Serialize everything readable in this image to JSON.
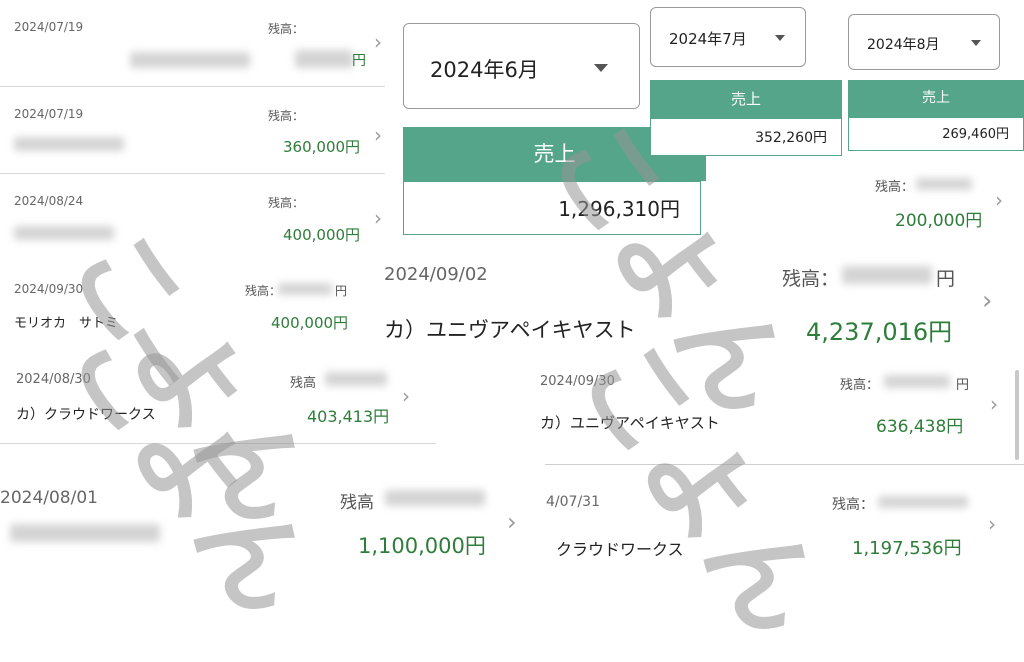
{
  "left_list": [
    {
      "date": "2024/07/19",
      "balance_label": "残高：",
      "name": "",
      "amount": ""
    },
    {
      "date": "2024/07/19",
      "balance_label": "残高：",
      "name": "",
      "amount": "360,000円"
    },
    {
      "date": "2024/08/24",
      "balance_label": "残高：",
      "name": "",
      "amount": "400,000円"
    },
    {
      "date": "2024/09/30",
      "balance_label": "残高：",
      "name": "モリオカ　サトミ",
      "amount": "400,000円"
    },
    {
      "date": "2024/08/30",
      "balance_label": "残高",
      "name": "カ）クラウドワークス",
      "amount": "403,413円"
    },
    {
      "date": "2024/08/01",
      "balance_label": "残高",
      "name": "",
      "amount": "1,100,000円"
    }
  ],
  "partial_yen": "円",
  "month_selectors": {
    "june": {
      "label": "2024年6月"
    },
    "july": {
      "label": "2024年7月"
    },
    "august": {
      "label": "2024年8月"
    }
  },
  "sales": {
    "header": "売上",
    "june": "1,296,310円",
    "july": "352,260円",
    "august": "269,460円"
  },
  "right_list": [
    {
      "date": "",
      "balance_label": "残高：",
      "name": "",
      "amount": "200,000円"
    },
    {
      "date": "2024/09/02",
      "balance_label": "残高：",
      "balance_suffix": "円",
      "name": "カ）ユニヴアペイキヤスト",
      "amount": "4,237,016円"
    },
    {
      "date": "2024/09/30",
      "balance_label": "残高：",
      "balance_suffix": "円",
      "name": "カ）ユニヴアペイキヤスト",
      "amount": "636,438円"
    },
    {
      "date": "4/07/31",
      "balance_label": "残高：",
      "name": "クラウドワークス",
      "amount": "1,197,536円"
    }
  ],
  "watermark": "こよん",
  "colors": {
    "accent": "#55a58a",
    "amount_green": "#2f7d3a"
  },
  "icons": {
    "chevron": "chevron-right-icon",
    "caret": "caret-down-icon"
  }
}
